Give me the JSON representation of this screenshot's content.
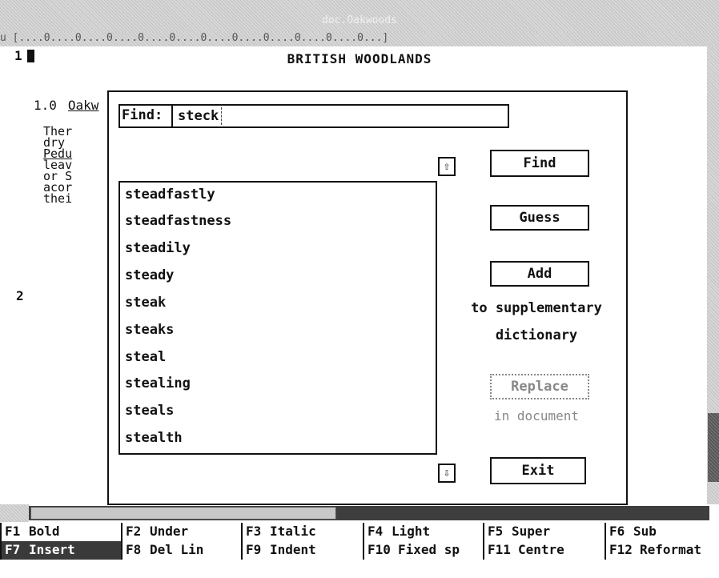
{
  "window": {
    "title": "doc.Oakwoods"
  },
  "ruler": {
    "text": "u [....0....0....0....0....0....0....0....0....0....0....0...]"
  },
  "document": {
    "title": "BRITISH WOODLANDS",
    "page_markers": [
      "1",
      "2"
    ],
    "section_number": "1.0",
    "section_title": "Oakw",
    "paragraph_lines": [
      "Ther",
      "dry",
      "Pedu",
      "leav",
      "or S",
      "acor",
      "thei"
    ]
  },
  "dialog": {
    "find_label": "Find:",
    "find_value": "steck",
    "words": [
      "steadfastly",
      "steadfastness",
      "steadily",
      "steady",
      "steak",
      "steaks",
      "steal",
      "stealing",
      "steals",
      "stealth"
    ],
    "scroll_up_glyph": "⇧",
    "scroll_down_glyph": "⇩",
    "buttons": {
      "find": "Find",
      "guess": "Guess",
      "add": "Add",
      "add_caption_1": "to supplementary",
      "add_caption_2": "dictionary",
      "replace": "Replace",
      "replace_caption": "in document",
      "exit": "Exit"
    }
  },
  "function_keys": {
    "row1": [
      {
        "key": "F1",
        "label": "Bold"
      },
      {
        "key": "F2",
        "label": "Under"
      },
      {
        "key": "F3",
        "label": "Italic"
      },
      {
        "key": "F4",
        "label": "Light"
      },
      {
        "key": "F5",
        "label": "Super"
      },
      {
        "key": "F6",
        "label": "Sub"
      }
    ],
    "row2": [
      {
        "key": "F7",
        "label": "Insert"
      },
      {
        "key": "F8",
        "label": "Del Lin"
      },
      {
        "key": "F9",
        "label": "Indent"
      },
      {
        "key": "F10",
        "label": "Fixed sp"
      },
      {
        "key": "F11",
        "label": "Centre"
      },
      {
        "key": "F12",
        "label": "Reformat"
      }
    ]
  },
  "colors": {
    "highlight": "#3a3a3a",
    "disabled": "#888888"
  }
}
